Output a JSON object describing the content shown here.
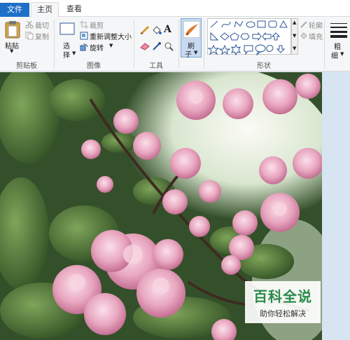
{
  "tabs": [
    {
      "label": "文件"
    },
    {
      "label": "主页"
    },
    {
      "label": "查看"
    }
  ],
  "clipboard": {
    "paste": "粘贴",
    "cut": "裁切",
    "copy": "复制",
    "group": "剪贴板"
  },
  "image": {
    "select": "选",
    "select2": "择",
    "crop": "裁剪",
    "resize": "重新调整大小",
    "rotate": "旋转",
    "group": "图像"
  },
  "tools": {
    "group": "工具"
  },
  "brush": {
    "label": "刷",
    "label2": "子"
  },
  "shapes": {
    "outline": "轮廓",
    "fill": "填充",
    "group": "形状"
  },
  "size": {
    "label": "粗",
    "label2": "细"
  },
  "watermark": {
    "title": "百科全说",
    "subtitle": "助你轻松解决"
  },
  "colors": {
    "accent": "#1e6fc8",
    "ribbon": "#f5f6f7",
    "workspace": "#d7e4f2",
    "watermark_green": "#2a8a4a"
  }
}
